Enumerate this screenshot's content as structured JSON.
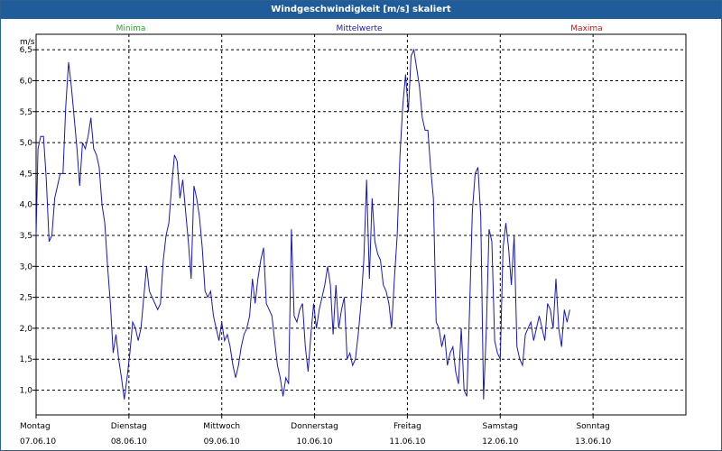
{
  "window": {
    "title": "Windgeschwindigkeit [m/s] skaliert"
  },
  "legend": [
    {
      "label": "Minima",
      "color": "#22aa22"
    },
    {
      "label": "Mittelwerte",
      "color": "#1a1aaa"
    },
    {
      "label": "Maxima",
      "color": "#aa2222"
    }
  ],
  "chart_data": {
    "type": "line",
    "ylabel": "m/s",
    "ylim": [
      0.6,
      6.75
    ],
    "yticks": [
      "1,0",
      "1,5",
      "2,0",
      "2,5",
      "3,0",
      "3,5",
      "4,0",
      "4,5",
      "5,0",
      "5,5",
      "6,0",
      "6,5"
    ],
    "ytick_values": [
      1.0,
      1.5,
      2.0,
      2.5,
      3.0,
      3.5,
      4.0,
      4.5,
      5.0,
      5.5,
      6.0,
      6.5
    ],
    "xlim": [
      0,
      7
    ],
    "days": [
      {
        "day": "Montag",
        "date": "07.06.10"
      },
      {
        "day": "Dienstag",
        "date": "08.06.10"
      },
      {
        "day": "Mittwoch",
        "date": "09.06.10"
      },
      {
        "day": "Donnerstag",
        "date": "10.06.10"
      },
      {
        "day": "Freitag",
        "date": "11.06.10"
      },
      {
        "day": "Samstag",
        "date": "12.06.10"
      },
      {
        "day": "Sonntag",
        "date": "13.06.10"
      }
    ],
    "grid": true,
    "series": [
      {
        "name": "Mittelwerte",
        "color": "#1a1aaa",
        "points": [
          [
            0.0,
            3.5
          ],
          [
            0.02,
            4.9
          ],
          [
            0.05,
            5.1
          ],
          [
            0.08,
            5.1
          ],
          [
            0.11,
            4.4
          ],
          [
            0.14,
            3.4
          ],
          [
            0.17,
            3.5
          ],
          [
            0.2,
            4.1
          ],
          [
            0.23,
            4.3
          ],
          [
            0.26,
            4.5
          ],
          [
            0.29,
            4.5
          ],
          [
            0.32,
            5.6
          ],
          [
            0.35,
            6.3
          ],
          [
            0.38,
            5.9
          ],
          [
            0.41,
            5.4
          ],
          [
            0.44,
            4.9
          ],
          [
            0.47,
            4.3
          ],
          [
            0.5,
            5.0
          ],
          [
            0.53,
            4.9
          ],
          [
            0.56,
            5.1
          ],
          [
            0.59,
            5.4
          ],
          [
            0.62,
            4.9
          ],
          [
            0.65,
            4.8
          ],
          [
            0.68,
            4.6
          ],
          [
            0.71,
            4.0
          ],
          [
            0.74,
            3.7
          ],
          [
            0.77,
            3.0
          ],
          [
            0.8,
            2.4
          ],
          [
            0.83,
            1.6
          ],
          [
            0.86,
            1.9
          ],
          [
            0.89,
            1.5
          ],
          [
            0.92,
            1.2
          ],
          [
            0.95,
            0.85
          ],
          [
            0.98,
            1.2
          ],
          [
            1.01,
            1.6
          ],
          [
            1.04,
            2.1
          ],
          [
            1.07,
            2.0
          ],
          [
            1.1,
            1.8
          ],
          [
            1.13,
            2.0
          ],
          [
            1.16,
            2.5
          ],
          [
            1.19,
            3.0
          ],
          [
            1.22,
            2.6
          ],
          [
            1.25,
            2.5
          ],
          [
            1.28,
            2.4
          ],
          [
            1.31,
            2.3
          ],
          [
            1.34,
            2.4
          ],
          [
            1.37,
            3.1
          ],
          [
            1.4,
            3.5
          ],
          [
            1.43,
            3.7
          ],
          [
            1.46,
            4.3
          ],
          [
            1.49,
            4.8
          ],
          [
            1.52,
            4.7
          ],
          [
            1.55,
            4.1
          ],
          [
            1.58,
            4.4
          ],
          [
            1.61,
            3.9
          ],
          [
            1.64,
            3.4
          ],
          [
            1.67,
            2.8
          ],
          [
            1.7,
            4.3
          ],
          [
            1.73,
            4.1
          ],
          [
            1.76,
            3.8
          ],
          [
            1.79,
            3.3
          ],
          [
            1.82,
            2.6
          ],
          [
            1.85,
            2.5
          ],
          [
            1.88,
            2.6
          ],
          [
            1.91,
            2.2
          ],
          [
            1.94,
            2.0
          ],
          [
            1.97,
            1.8
          ],
          [
            2.0,
            2.1
          ],
          [
            2.03,
            1.8
          ],
          [
            2.06,
            1.9
          ],
          [
            2.09,
            1.7
          ],
          [
            2.12,
            1.4
          ],
          [
            2.15,
            1.2
          ],
          [
            2.18,
            1.4
          ],
          [
            2.21,
            1.7
          ],
          [
            2.24,
            1.9
          ],
          [
            2.27,
            2.0
          ],
          [
            2.3,
            2.2
          ],
          [
            2.33,
            2.8
          ],
          [
            2.36,
            2.4
          ],
          [
            2.39,
            2.8
          ],
          [
            2.42,
            3.1
          ],
          [
            2.45,
            3.3
          ],
          [
            2.48,
            2.4
          ],
          [
            2.51,
            2.3
          ],
          [
            2.54,
            2.2
          ],
          [
            2.57,
            1.8
          ],
          [
            2.6,
            1.4
          ],
          [
            2.63,
            1.2
          ],
          [
            2.66,
            0.9
          ],
          [
            2.69,
            1.2
          ],
          [
            2.72,
            1.1
          ],
          [
            2.75,
            3.6
          ],
          [
            2.78,
            2.2
          ],
          [
            2.81,
            2.1
          ],
          [
            2.84,
            2.3
          ],
          [
            2.87,
            2.4
          ],
          [
            2.9,
            1.7
          ],
          [
            2.93,
            1.3
          ],
          [
            2.96,
            1.9
          ],
          [
            2.99,
            2.4
          ],
          [
            3.02,
            2.0
          ],
          [
            3.05,
            2.3
          ],
          [
            3.08,
            2.5
          ],
          [
            3.11,
            2.7
          ],
          [
            3.14,
            3.0
          ],
          [
            3.17,
            2.7
          ],
          [
            3.2,
            1.9
          ],
          [
            3.23,
            2.7
          ],
          [
            3.26,
            2.0
          ],
          [
            3.29,
            2.3
          ],
          [
            3.32,
            2.5
          ],
          [
            3.35,
            1.5
          ],
          [
            3.38,
            1.6
          ],
          [
            3.41,
            1.4
          ],
          [
            3.44,
            1.5
          ],
          [
            3.47,
            1.9
          ],
          [
            3.5,
            2.4
          ],
          [
            3.53,
            3.1
          ],
          [
            3.56,
            4.4
          ],
          [
            3.59,
            2.8
          ],
          [
            3.62,
            4.1
          ],
          [
            3.65,
            3.4
          ],
          [
            3.68,
            3.2
          ],
          [
            3.71,
            3.1
          ],
          [
            3.74,
            2.7
          ],
          [
            3.77,
            2.6
          ],
          [
            3.8,
            2.4
          ],
          [
            3.83,
            2.0
          ],
          [
            3.86,
            2.8
          ],
          [
            3.89,
            3.5
          ],
          [
            3.92,
            4.8
          ],
          [
            3.95,
            5.6
          ],
          [
            3.98,
            6.1
          ],
          [
            4.01,
            5.5
          ],
          [
            4.04,
            6.4
          ],
          [
            4.07,
            6.5
          ],
          [
            4.1,
            6.2
          ],
          [
            4.13,
            5.9
          ],
          [
            4.16,
            5.4
          ],
          [
            4.19,
            5.2
          ],
          [
            4.22,
            5.2
          ],
          [
            4.25,
            4.6
          ],
          [
            4.28,
            4.1
          ],
          [
            4.31,
            2.1
          ],
          [
            4.34,
            2.0
          ],
          [
            4.37,
            1.7
          ],
          [
            4.4,
            1.9
          ],
          [
            4.43,
            1.4
          ],
          [
            4.46,
            1.6
          ],
          [
            4.49,
            1.7
          ],
          [
            4.52,
            1.3
          ],
          [
            4.55,
            1.1
          ],
          [
            4.58,
            2.0
          ],
          [
            4.61,
            1.0
          ],
          [
            4.64,
            0.9
          ],
          [
            4.67,
            2.3
          ],
          [
            4.7,
            3.9
          ],
          [
            4.73,
            4.5
          ],
          [
            4.76,
            4.6
          ],
          [
            4.79,
            3.8
          ],
          [
            4.82,
            0.85
          ],
          [
            4.85,
            2.0
          ],
          [
            4.88,
            3.6
          ],
          [
            4.91,
            3.4
          ],
          [
            4.94,
            1.8
          ],
          [
            4.97,
            1.6
          ],
          [
            5.0,
            1.5
          ],
          [
            5.03,
            3.3
          ],
          [
            5.06,
            3.7
          ],
          [
            5.09,
            3.3
          ],
          [
            5.12,
            2.7
          ],
          [
            5.15,
            3.5
          ],
          [
            5.18,
            1.7
          ],
          [
            5.21,
            1.5
          ],
          [
            5.24,
            1.4
          ],
          [
            5.27,
            1.9
          ],
          [
            5.3,
            2.0
          ],
          [
            5.33,
            2.1
          ],
          [
            5.36,
            1.8
          ],
          [
            5.39,
            2.0
          ],
          [
            5.42,
            2.2
          ],
          [
            5.45,
            2.0
          ],
          [
            5.48,
            1.8
          ],
          [
            5.51,
            2.4
          ],
          [
            5.54,
            2.3
          ],
          [
            5.57,
            2.0
          ],
          [
            5.6,
            2.8
          ],
          [
            5.63,
            2.0
          ],
          [
            5.66,
            1.7
          ],
          [
            5.69,
            2.3
          ],
          [
            5.72,
            2.1
          ],
          [
            5.75,
            2.3
          ]
        ]
      }
    ]
  }
}
